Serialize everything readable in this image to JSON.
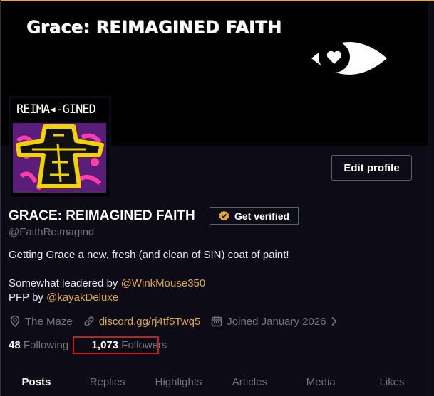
{
  "banner": {
    "title": "Grace: REIMAGINED FAITH"
  },
  "pfp": {
    "label": "REIMA◂◦GINED"
  },
  "profile": {
    "edit_label": "Edit profile",
    "display_name": "GRACE: REIMAGINED FAITH",
    "verify_label": "Get verified",
    "handle": "@FaithReimagind",
    "bio_line1": "Getting Grace a new, fresh (and clean of SIN) coat of paint!",
    "bio_line2_prefix": "Somewhat leadered by ",
    "bio_line2_mention": "@WinkMouse350",
    "bio_line3_prefix": "PFP by ",
    "bio_line3_mention": "@kayakDeluxe"
  },
  "meta": {
    "location": "The Maze",
    "website": "discord.gg/rj4tf5Twq5",
    "joined": "Joined January 2026"
  },
  "stats": {
    "following_count": "48",
    "following_label": "Following",
    "followers_count": "1,073",
    "followers_label": "Followers"
  },
  "tabs": [
    "Posts",
    "Replies",
    "Highlights",
    "Articles",
    "Media",
    "Likes"
  ],
  "colors": {
    "accent": "#e0a93a",
    "bg": "#0d0b16",
    "highlight_box": "#d11a1a"
  },
  "icons": [
    "eye-icon",
    "verified-badge-icon",
    "location-icon",
    "link-icon",
    "calendar-icon",
    "chevron-right-icon"
  ]
}
